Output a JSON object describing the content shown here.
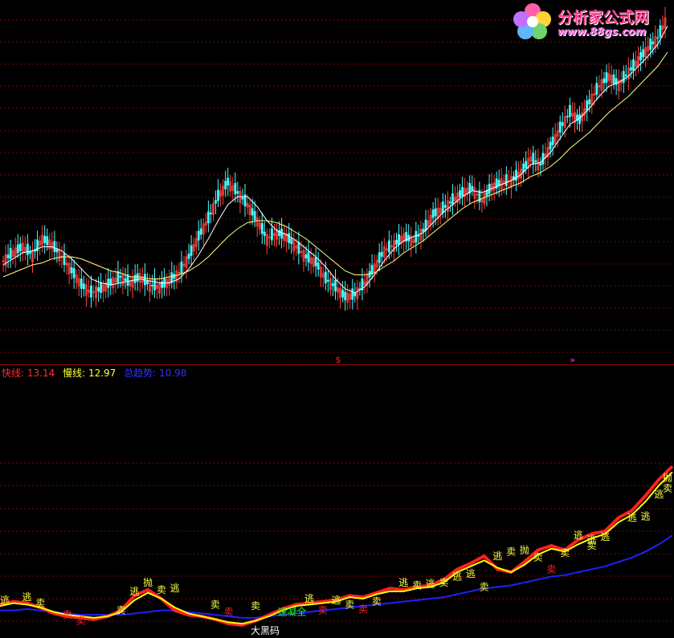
{
  "watermark": {
    "site_name": "分析家公式网",
    "url": "www.88gs.com"
  },
  "colors": {
    "background": "#000000",
    "grid": "#8b0000",
    "up_candle": "#ff4040",
    "down_candle": "#40ffff",
    "ma_fast": "#ffffff",
    "ma_slow": "#ffff80",
    "fast_line": "#ff2020",
    "slow_line": "#ffff00",
    "trend_line": "#2020ff",
    "label_yellow": "#ffff40",
    "label_red": "#ff2020",
    "label_green": "#20ff20",
    "label_white": "#ffffff"
  },
  "legend": {
    "fast_label": "快线:",
    "fast_value": "13.14",
    "slow_label": "慢线:",
    "slow_value": "12.97",
    "trend_label": "总趋势:",
    "trend_value": "10.98"
  },
  "chart_data": [
    {
      "type": "candlestick",
      "panel": "main",
      "series": [
        {
          "name": "close",
          "values": [
            2.2,
            2.6,
            2.9,
            2.5,
            3.3,
            3.0,
            2.4,
            1.7,
            1.0,
            0.6,
            0.8,
            1.1,
            1.4,
            1.1,
            1.4,
            1.0,
            0.9,
            1.2,
            1.6,
            2.4,
            3.4,
            4.3,
            5.4,
            6.1,
            5.6,
            5.0,
            4.2,
            3.3,
            3.6,
            3.4,
            2.9,
            2.4,
            2.1,
            1.3,
            0.9,
            0.4,
            0.5,
            1.1,
            1.9,
            2.7,
            3.0,
            3.4,
            3.2,
            3.7,
            4.5,
            4.8,
            5.2,
            5.6,
            5.8,
            5.2,
            5.9,
            6.1,
            6.2,
            6.6,
            7.3,
            7.0,
            7.9,
            8.8,
            9.6,
            9.2,
            10.1,
            10.9,
            11.4,
            11.0,
            11.6,
            12.2,
            12.8,
            13.3,
            14.4
          ]
        },
        {
          "name": "ma_fast",
          "values": [
            2.0,
            2.3,
            2.6,
            2.7,
            2.9,
            2.9,
            2.7,
            2.3,
            1.8,
            1.3,
            1.1,
            1.0,
            1.1,
            1.2,
            1.3,
            1.2,
            1.1,
            1.1,
            1.3,
            1.8,
            2.5,
            3.3,
            4.2,
            5.0,
            5.4,
            5.4,
            4.9,
            4.2,
            3.7,
            3.5,
            3.2,
            2.8,
            2.4,
            1.9,
            1.3,
            0.8,
            0.6,
            0.9,
            1.5,
            2.2,
            2.8,
            3.2,
            3.4,
            3.6,
            4.1,
            4.6,
            5.0,
            5.4,
            5.7,
            5.6,
            5.8,
            6.0,
            6.2,
            6.5,
            7.0,
            7.1,
            7.6,
            8.3,
            9.0,
            9.3,
            9.8,
            10.4,
            10.9,
            11.1,
            11.4,
            11.9,
            12.4,
            13.0,
            13.9
          ]
        },
        {
          "name": "ma_slow",
          "values": [
            1.4,
            1.6,
            1.8,
            2.0,
            2.1,
            2.3,
            2.4,
            2.4,
            2.3,
            2.1,
            1.9,
            1.7,
            1.6,
            1.4,
            1.4,
            1.3,
            1.3,
            1.4,
            1.5,
            1.7,
            2.0,
            2.4,
            2.9,
            3.4,
            3.8,
            4.1,
            4.2,
            4.2,
            4.1,
            3.9,
            3.6,
            3.3,
            2.9,
            2.5,
            2.1,
            1.7,
            1.5,
            1.5,
            1.6,
            1.9,
            2.2,
            2.6,
            2.9,
            3.2,
            3.6,
            4.0,
            4.4,
            4.8,
            5.1,
            5.3,
            5.5,
            5.7,
            5.9,
            6.1,
            6.4,
            6.6,
            6.9,
            7.3,
            7.8,
            8.2,
            8.6,
            9.1,
            9.6,
            10.0,
            10.4,
            10.9,
            11.4,
            11.9,
            12.6
          ]
        }
      ]
    },
    {
      "type": "line",
      "panel": "indicator",
      "series": [
        {
          "name": "快线",
          "values": [
            2.0,
            2.2,
            2.1,
            1.8,
            1.4,
            1.2,
            1.1,
            1.0,
            1.2,
            1.6,
            2.6,
            3.0,
            2.4,
            1.6,
            1.3,
            1.2,
            1.0,
            0.7,
            0.6,
            0.9,
            1.3,
            1.7,
            2.0,
            2.1,
            2.2,
            2.3,
            2.6,
            2.5,
            2.8,
            3.1,
            3.0,
            3.2,
            3.3,
            3.7,
            4.4,
            4.8,
            5.3,
            4.4,
            4.2,
            4.9,
            5.7,
            6.0,
            5.7,
            6.4,
            6.8,
            7.0,
            7.9,
            8.4,
            9.4,
            10.5,
            11.4
          ]
        },
        {
          "name": "慢线",
          "values": [
            1.9,
            2.1,
            2.0,
            1.8,
            1.5,
            1.3,
            1.2,
            1.1,
            1.2,
            1.5,
            2.3,
            2.8,
            2.4,
            1.8,
            1.4,
            1.2,
            1.0,
            0.8,
            0.7,
            0.9,
            1.2,
            1.6,
            1.9,
            2.0,
            2.1,
            2.2,
            2.5,
            2.4,
            2.7,
            2.9,
            2.9,
            3.1,
            3.2,
            3.5,
            4.2,
            4.6,
            5.0,
            4.5,
            4.2,
            4.7,
            5.4,
            5.8,
            5.6,
            6.1,
            6.5,
            6.8,
            7.6,
            8.1,
            9.0,
            10.1,
            11.0
          ]
        },
        {
          "name": "总趋势",
          "values": [
            1.6,
            1.6,
            1.7,
            1.6,
            1.5,
            1.4,
            1.3,
            1.3,
            1.3,
            1.3,
            1.4,
            1.5,
            1.6,
            1.6,
            1.5,
            1.4,
            1.3,
            1.2,
            1.1,
            1.1,
            1.2,
            1.3,
            1.4,
            1.5,
            1.6,
            1.7,
            1.8,
            1.9,
            2.0,
            2.1,
            2.2,
            2.3,
            2.4,
            2.5,
            2.7,
            2.9,
            3.1,
            3.2,
            3.3,
            3.5,
            3.7,
            3.9,
            4.0,
            4.2,
            4.4,
            4.6,
            4.9,
            5.2,
            5.6,
            6.1,
            6.7
          ]
        }
      ]
    }
  ],
  "signals": [
    {
      "text": "逃",
      "color": "yellow",
      "x": 0,
      "y": 2.3
    },
    {
      "text": "卖",
      "color": "yellow",
      "x": 3,
      "y": 2.1
    },
    {
      "text": "逃",
      "color": "yellow",
      "x": 2,
      "y": 2.5
    },
    {
      "text": "卖",
      "color": "red",
      "x": 5,
      "y": 1.3
    },
    {
      "text": "卖",
      "color": "red",
      "x": 6,
      "y": 0.9
    },
    {
      "text": "卖",
      "color": "yellow",
      "x": 9,
      "y": 1.6
    },
    {
      "text": "逃",
      "color": "yellow",
      "x": 10,
      "y": 2.9
    },
    {
      "text": "抛",
      "color": "yellow",
      "x": 11,
      "y": 3.5
    },
    {
      "text": "卖",
      "color": "yellow",
      "x": 12,
      "y": 3.0
    },
    {
      "text": "逃",
      "color": "yellow",
      "x": 13,
      "y": 3.1
    },
    {
      "text": "卖",
      "color": "yellow",
      "x": 16,
      "y": 2.0
    },
    {
      "text": "卖",
      "color": "red",
      "x": 17,
      "y": 1.5
    },
    {
      "text": "卖",
      "color": "yellow",
      "x": 19,
      "y": 1.9
    },
    {
      "text": "大黑码",
      "color": "white",
      "x": 19,
      "y": 0.1
    },
    {
      "text": "逃",
      "color": "yellow",
      "x": 23,
      "y": 2.4
    },
    {
      "text": "速凝全",
      "color": "green",
      "x": 21,
      "y": 1.5
    },
    {
      "text": "卖",
      "color": "red",
      "x": 24,
      "y": 1.6
    },
    {
      "text": "逃",
      "color": "yellow",
      "x": 25,
      "y": 2.3
    },
    {
      "text": "卖",
      "color": "yellow",
      "x": 26,
      "y": 2.0
    },
    {
      "text": "卖",
      "color": "red",
      "x": 27,
      "y": 1.7
    },
    {
      "text": "卖",
      "color": "yellow",
      "x": 28,
      "y": 2.2
    },
    {
      "text": "逃",
      "color": "yellow",
      "x": 30,
      "y": 3.5
    },
    {
      "text": "卖",
      "color": "yellow",
      "x": 31,
      "y": 3.3
    },
    {
      "text": "逃",
      "color": "yellow",
      "x": 32,
      "y": 3.4
    },
    {
      "text": "卖",
      "color": "yellow",
      "x": 33,
      "y": 3.5
    },
    {
      "text": "逃",
      "color": "yellow",
      "x": 34,
      "y": 3.9
    },
    {
      "text": "逃",
      "color": "yellow",
      "x": 35,
      "y": 4.1
    },
    {
      "text": "卖",
      "color": "yellow",
      "x": 36,
      "y": 3.2
    },
    {
      "text": "逃",
      "color": "yellow",
      "x": 37,
      "y": 5.3
    },
    {
      "text": "卖",
      "color": "yellow",
      "x": 38,
      "y": 5.6
    },
    {
      "text": "抛",
      "color": "yellow",
      "x": 39,
      "y": 5.7
    },
    {
      "text": "卖",
      "color": "yellow",
      "x": 40,
      "y": 5.2
    },
    {
      "text": "卖",
      "color": "red",
      "x": 41,
      "y": 4.4
    },
    {
      "text": "卖",
      "color": "yellow",
      "x": 42,
      "y": 5.5
    },
    {
      "text": "逃",
      "color": "yellow",
      "x": 43,
      "y": 6.7
    },
    {
      "text": "逃",
      "color": "yellow",
      "x": 44,
      "y": 6.4
    },
    {
      "text": "卖",
      "color": "yellow",
      "x": 44,
      "y": 6.0
    },
    {
      "text": "逃",
      "color": "yellow",
      "x": 45,
      "y": 6.6
    },
    {
      "text": "逃",
      "color": "yellow",
      "x": 47,
      "y": 7.9
    },
    {
      "text": "逃",
      "color": "yellow",
      "x": 48,
      "y": 8.0
    },
    {
      "text": "逃",
      "color": "yellow",
      "x": 49,
      "y": 9.5
    },
    {
      "text": "抛",
      "color": "yellow",
      "x": 50,
      "y": 10.6
    },
    {
      "text": "卖",
      "color": "yellow",
      "x": 50,
      "y": 9.9
    }
  ],
  "main_markers": [
    {
      "text": "$",
      "color": "red",
      "x": 34
    },
    {
      "text": "»",
      "color": "magenta",
      "x": 58
    }
  ]
}
